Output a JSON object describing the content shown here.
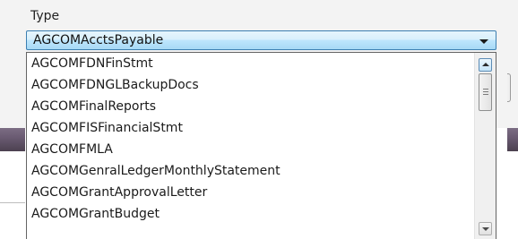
{
  "field": {
    "label": "Type",
    "selected_value": "AGCOMAcctsPayable"
  },
  "dropdown": {
    "options": [
      "AGCOMFDNFinStmt",
      "AGCOMFDNGLBackupDocs",
      "AGCOMFinalReports",
      "AGCOMFISFinancialStmt",
      "AGCOMFMLA",
      "AGCOMGenralLedgerMonthlyStatement",
      "AGCOMGrantApprovalLetter",
      "AGCOMGrantBudget"
    ]
  },
  "icons": {
    "select_arrow": "chevron-down-icon",
    "scroll_up": "arrow-up-icon",
    "scroll_down": "arrow-down-icon"
  },
  "colors": {
    "selected_gradient_top": "#e6f5fd",
    "selected_gradient_bottom": "#a7d9f5",
    "selected_border": "#3c7fb1"
  }
}
